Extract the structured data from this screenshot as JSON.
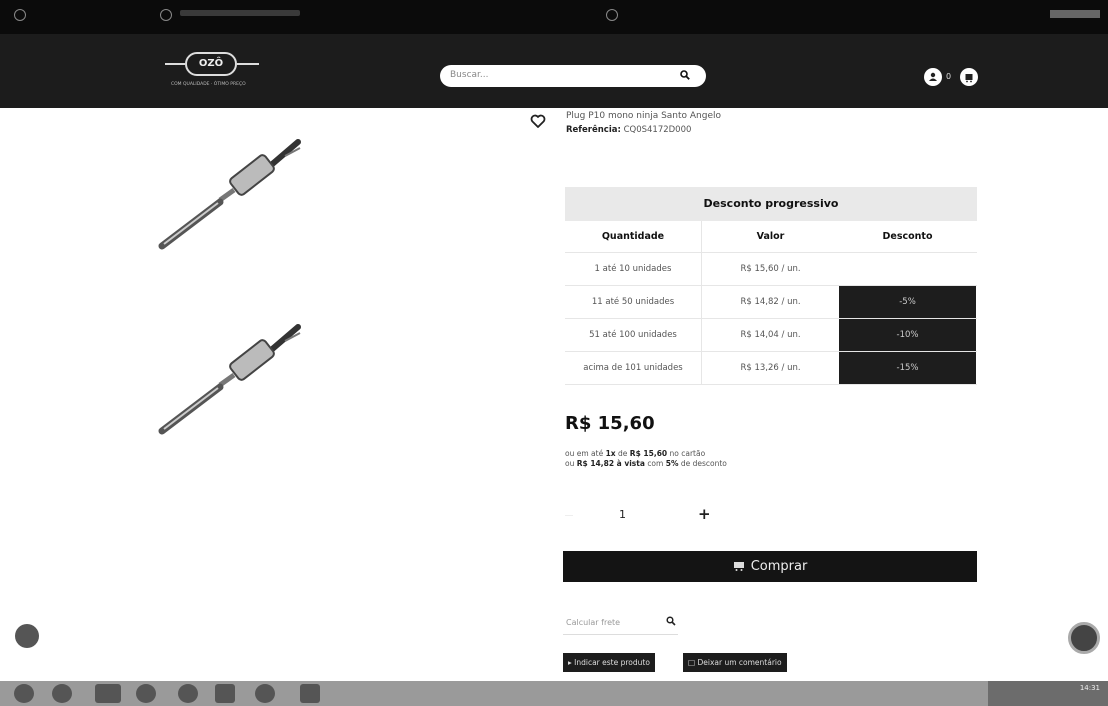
{
  "header": {
    "logo_text": "OZÔ",
    "logo_sub": "COM QUALIDADE · ÓTIMO PREÇO",
    "search_placeholder": "Buscar...",
    "cart_count": "0"
  },
  "product": {
    "name": "Plug P10 mono ninja Santo Angelo",
    "reference_label": "Referência:",
    "reference_value": "CQ0S4172D000"
  },
  "discount_table": {
    "title": "Desconto progressivo",
    "headers": [
      "Quantidade",
      "Valor",
      "Desconto"
    ],
    "rows": [
      {
        "qty": "1 até 10 unidades",
        "price": "R$ 15,60 / un.",
        "discount": ""
      },
      {
        "qty": "11 até 50 unidades",
        "price": "R$ 14,82 / un.",
        "discount": "-5%"
      },
      {
        "qty": "51 até 100 unidades",
        "price": "R$ 14,04 / un.",
        "discount": "-10%"
      },
      {
        "qty": "acima de 101 unidades",
        "price": "R$ 13,26 / un.",
        "discount": "-15%"
      }
    ]
  },
  "pricing": {
    "price": "R$ 15,60",
    "line1_prefix": "ou em até",
    "line1_installments": "1x",
    "line1_de": "de",
    "line1_amount": "R$ 15,60",
    "line1_suffix": "no cartão",
    "line2_prefix": "ou",
    "line2_amount": "R$ 14,82 à vista",
    "line2_com": "com",
    "line2_percent": "5%",
    "line2_suffix": "de desconto"
  },
  "quantity": {
    "value": "1",
    "plus": "+"
  },
  "buy_label": "Comprar",
  "shipping_placeholder": "Calcular frete",
  "actions": {
    "recommend": "Indicar este produto",
    "comment": "Deixar um comentário"
  },
  "taskbar": {
    "time": "14:31"
  },
  "colors": {
    "header_bg": "#1c1c1c",
    "dark_button": "#141414",
    "discount_bg": "#1d1d1d"
  }
}
